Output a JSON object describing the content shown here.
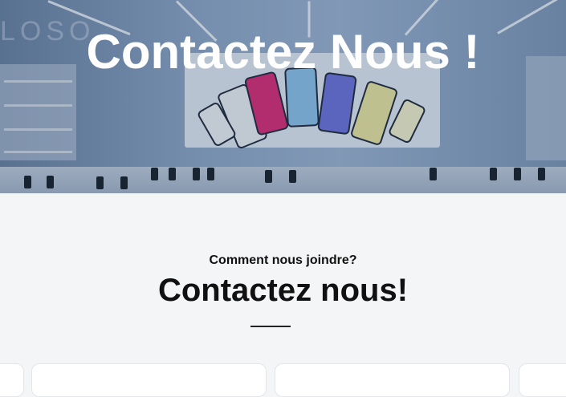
{
  "hero": {
    "title": "Contactez Nous !",
    "store_sign": "LOSO"
  },
  "section": {
    "subtitle": "Comment nous joindre?",
    "title": "Contactez nous!"
  },
  "colors": {
    "hero_overlay": "#3b4b63",
    "page_bg": "#f4f5f7",
    "card_bg": "#ffffff",
    "text": "#111111"
  }
}
